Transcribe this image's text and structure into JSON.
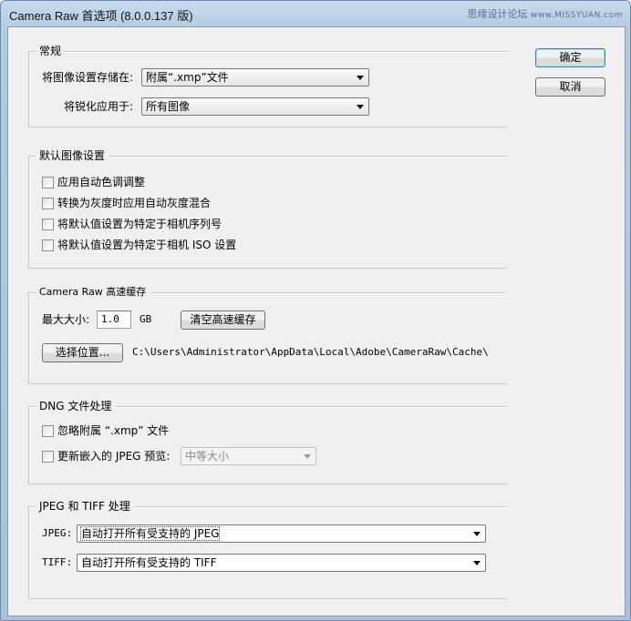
{
  "window": {
    "title": "Camera Raw 首选项 (8.0.0.137 版)",
    "watermark": "思缘设计论坛",
    "watermark_site": "www.MISSYUAN.com"
  },
  "buttons": {
    "ok": "确定",
    "cancel": "取消"
  },
  "general": {
    "title": "常规",
    "save_settings_label": "将图像设置存储在:",
    "save_settings_value": "附属“.xmp”文件",
    "sharpening_label": "将锐化应用于:",
    "sharpening_value": "所有图像"
  },
  "defaults": {
    "title": "默认图像设置",
    "options": [
      "应用自动色调调整",
      "转换为灰度时应用自动灰度混合",
      "将默认值设置为特定于相机序列号",
      "将默认值设置为特定于相机 ISO 设置"
    ]
  },
  "cache": {
    "title": "Camera Raw 高速缓存",
    "max_size_label": "最大大小:",
    "max_size_value": "1.0",
    "unit": "GB",
    "purge_button": "清空高速缓存",
    "location_button": "选择位置...",
    "path": "C:\\Users\\Administrator\\AppData\\Local\\Adobe\\CameraRaw\\Cache\\"
  },
  "dng": {
    "title": "DNG 文件处理",
    "ignore_sidecar": "忽略附属 “.xmp” 文件",
    "update_preview": "更新嵌入的 JPEG 预览:",
    "preview_size": "中等大小"
  },
  "jpeg_tiff": {
    "title": "JPEG 和 TIFF 处理",
    "jpeg_label": "JPEG:",
    "jpeg_value": "自动打开所有受支持的 JPEG",
    "tiff_label": "TIFF:",
    "tiff_value": "自动打开所有受支持的 TIFF"
  }
}
